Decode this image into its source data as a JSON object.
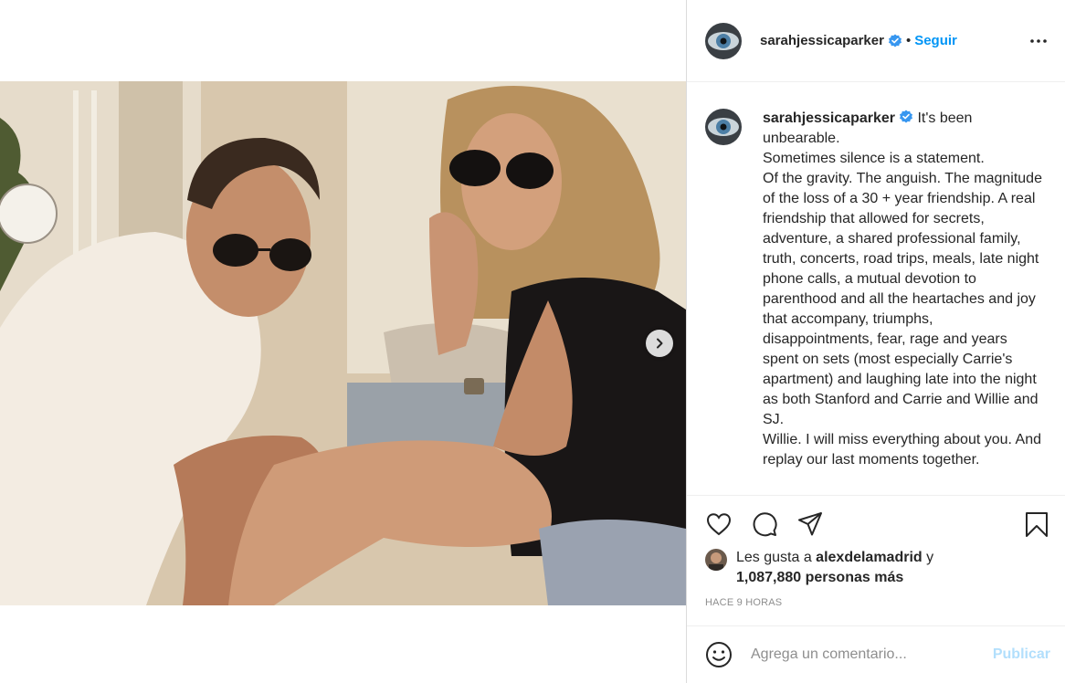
{
  "post": {
    "username": "sarahjessicaparker",
    "verified": true,
    "follow_label": "Seguir",
    "separator": "•",
    "more_icon": "more-options-icon"
  },
  "photo": {
    "description_icon": "post-photo",
    "next_icon": "chevron-right-icon"
  },
  "caption": {
    "username": "sarahjessicaparker",
    "text": "It's been unbearable.\nSometimes silence is a statement.\nOf the gravity. The anguish. The magnitude of the loss of a 30 + year friendship. A real friendship that allowed for secrets, adventure, a shared professional family, truth, concerts, road trips, meals, late night phone calls, a mutual devotion to parenthood and all the heartaches and joy that accompany, triumphs, disappointments, fear, rage and years spent on sets (most especially Carrie's apartment) and laughing late into the night as both Stanford and Carrie and Willie and SJ.\nWillie. I will miss everything about you. And replay our last moments together."
  },
  "actions": {
    "like_icon": "heart-icon",
    "comment_icon": "comment-bubble-icon",
    "share_icon": "send-icon",
    "save_icon": "bookmark-icon"
  },
  "likes": {
    "prefix": "Les gusta a ",
    "user": "alexdelamadrid",
    "connector": " y",
    "count": "1,087,880 personas más"
  },
  "timestamp": "HACE 9 HORAS",
  "comment_box": {
    "placeholder": "Agrega un comentario...",
    "publish_label": "Publicar",
    "emoji_icon": "smiley-icon"
  },
  "colors": {
    "link_blue": "#0095f6",
    "publish_disabled": "#b2dffc",
    "muted": "#8e8e8e",
    "text": "#262626"
  }
}
